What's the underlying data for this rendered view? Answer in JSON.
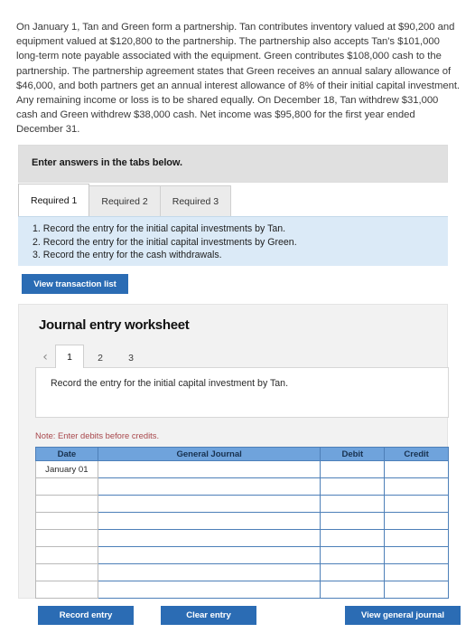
{
  "problem": {
    "text": "On January 1, Tan and Green form a partnership. Tan contributes inventory valued at $90,200 and equipment valued at $120,800 to the partnership. The partnership also accepts Tan's $101,000 long-term note payable associated with the equipment. Green contributes $108,000 cash to the partnership. The partnership agreement states that Green receives an annual salary allowance of $46,000, and both partners get an annual interest allowance of 8% of their initial capital investment. Any remaining income or loss is to be shared equally. On December 18, Tan withdrew $31,000 cash and Green withdrew $38,000 cash. Net income was $95,800 for the first year ended December 31."
  },
  "banner": {
    "text": "Enter answers in the tabs below."
  },
  "required_tabs": [
    {
      "label": "Required 1",
      "active": true
    },
    {
      "label": "Required 2",
      "active": false
    },
    {
      "label": "Required 3",
      "active": false
    }
  ],
  "requirements": [
    "1. Record the entry for the initial capital investments by Tan.",
    "2. Record the entry for the initial capital investments by Green.",
    "3. Record the entry for the cash withdrawals."
  ],
  "buttons": {
    "view_transaction_list": "View transaction list",
    "record_entry": "Record entry",
    "clear_entry": "Clear entry",
    "view_general_journal": "View general journal"
  },
  "worksheet": {
    "title": "Journal entry worksheet",
    "pager": {
      "prev_icon": "chevron-left-icon",
      "prev_glyph": "‹",
      "pages": [
        {
          "label": "1",
          "active": true
        },
        {
          "label": "2",
          "active": false
        },
        {
          "label": "3",
          "active": false
        }
      ]
    },
    "description": "Record the entry for the initial capital investment by Tan.",
    "note": "Note: Enter debits before credits.",
    "table": {
      "columns": [
        "Date",
        "General Journal",
        "Debit",
        "Credit"
      ],
      "rows": [
        {
          "date": "January 01",
          "general_journal": "",
          "debit": "",
          "credit": ""
        },
        {
          "date": "",
          "general_journal": "",
          "debit": "",
          "credit": ""
        },
        {
          "date": "",
          "general_journal": "",
          "debit": "",
          "credit": ""
        },
        {
          "date": "",
          "general_journal": "",
          "debit": "",
          "credit": ""
        },
        {
          "date": "",
          "general_journal": "",
          "debit": "",
          "credit": ""
        },
        {
          "date": "",
          "general_journal": "",
          "debit": "",
          "credit": ""
        },
        {
          "date": "",
          "general_journal": "",
          "debit": "",
          "credit": ""
        },
        {
          "date": "",
          "general_journal": "",
          "debit": "",
          "credit": ""
        }
      ]
    }
  },
  "colors": {
    "accent_blue": "#2b6cb4",
    "table_header_blue": "#6fa3dc",
    "info_panel_blue": "#dbeaf7",
    "banner_gray": "#e0e0e0",
    "note_red": "#a8474c"
  }
}
